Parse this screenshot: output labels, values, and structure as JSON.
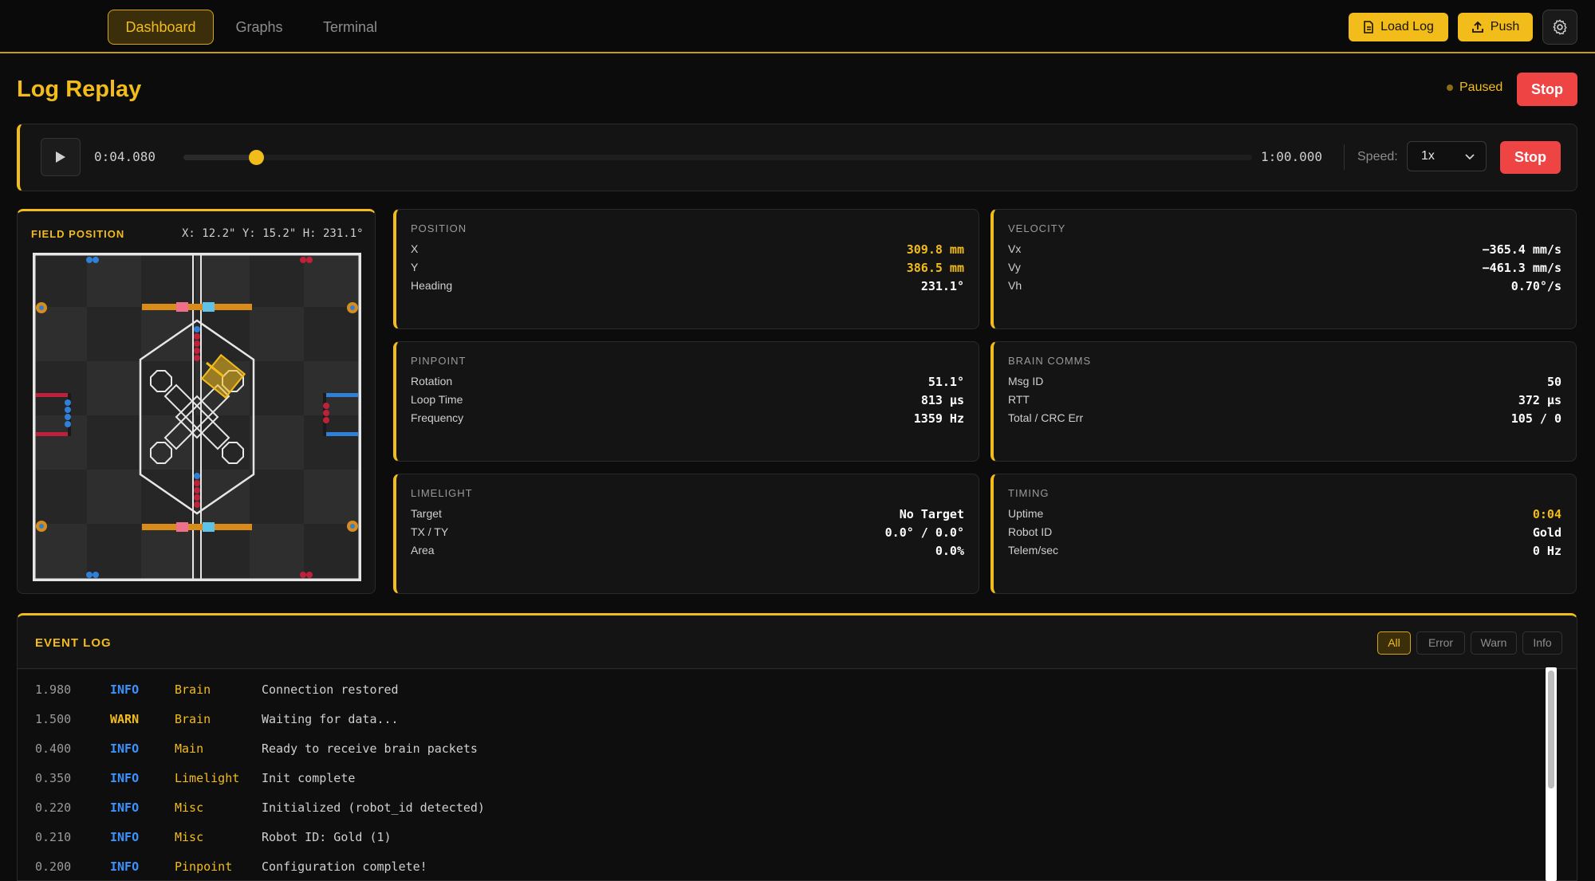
{
  "nav": {
    "tabs": [
      {
        "label": "Dashboard",
        "active": true
      },
      {
        "label": "Graphs",
        "active": false
      },
      {
        "label": "Terminal",
        "active": false
      }
    ],
    "load_log_label": "Load Log",
    "push_label": "Push",
    "settings_icon": "gear-icon"
  },
  "header": {
    "title": "Log Replay",
    "status": "Paused",
    "stop_label": "Stop"
  },
  "playback": {
    "current_time": "0:04.080",
    "end_time": "1:00.000",
    "progress": 0.068,
    "speed_label": "Speed:",
    "speed_value": "1x",
    "stop_label": "Stop"
  },
  "field": {
    "title": "FIELD POSITION",
    "coords": "X: 12.2\" Y: 15.2\" H: 231.1°"
  },
  "position": {
    "label": "POSITION",
    "rows": [
      {
        "key": "X",
        "value": "309.8 mm"
      },
      {
        "key": "Y",
        "value": "386.5 mm"
      },
      {
        "key": "Heading",
        "value": "231.1°"
      }
    ]
  },
  "velocity": {
    "label": "VELOCITY",
    "rows": [
      {
        "key": "Vx",
        "value": "−365.4 mm/s"
      },
      {
        "key": "Vy",
        "value": "−461.3 mm/s"
      },
      {
        "key": "Vh",
        "value": "0.70°/s"
      }
    ]
  },
  "pinpoint": {
    "label": "PINPOINT",
    "rows": [
      {
        "key": "Rotation",
        "value": "51.1°"
      },
      {
        "key": "Loop Time",
        "value": "813 µs"
      },
      {
        "key": "Frequency",
        "value": "1359 Hz"
      }
    ]
  },
  "brain": {
    "label": "BRAIN COMMS",
    "rows": [
      {
        "key": "Msg ID",
        "value": "50"
      },
      {
        "key": "RTT",
        "value": "372 µs"
      },
      {
        "key": "Total / CRC Err",
        "value": "105 / 0"
      }
    ]
  },
  "limelight": {
    "label": "LIMELIGHT",
    "rows": [
      {
        "key": "Target",
        "value": "No Target"
      },
      {
        "key": "TX / TY",
        "value": "0.0° / 0.0°"
      },
      {
        "key": "Area",
        "value": "0.0%"
      }
    ]
  },
  "timing": {
    "label": "TIMING",
    "rows": [
      {
        "key": "Uptime",
        "value": "0:04"
      },
      {
        "key": "Robot ID",
        "value": "Gold"
      },
      {
        "key": "Telem/sec",
        "value": "0 Hz"
      }
    ]
  },
  "event_log": {
    "title": "EVENT LOG",
    "filters": [
      "All",
      "Error",
      "Warn",
      "Info"
    ],
    "entries": [
      {
        "time": "1.980",
        "level": "INFO",
        "source": "Brain",
        "message": "Connection restored"
      },
      {
        "time": "1.500",
        "level": "WARN",
        "source": "Brain",
        "message": "Waiting for data..."
      },
      {
        "time": "0.400",
        "level": "INFO",
        "source": "Main",
        "message": "Ready to receive brain packets"
      },
      {
        "time": "0.350",
        "level": "INFO",
        "source": "Limelight",
        "message": "Init complete"
      },
      {
        "time": "0.220",
        "level": "INFO",
        "source": "Misc",
        "message": "Initialized (robot_id detected)"
      },
      {
        "time": "0.210",
        "level": "INFO",
        "source": "Misc",
        "message": "Robot ID: Gold (1)"
      },
      {
        "time": "0.200",
        "level": "INFO",
        "source": "Pinpoint",
        "message": "Configuration complete!"
      }
    ]
  },
  "colors": {
    "accent": "#f2bc1b",
    "danger": "#ef4444",
    "info": "#3b93ff",
    "background": "#0c0c0c",
    "card": "#141414"
  }
}
